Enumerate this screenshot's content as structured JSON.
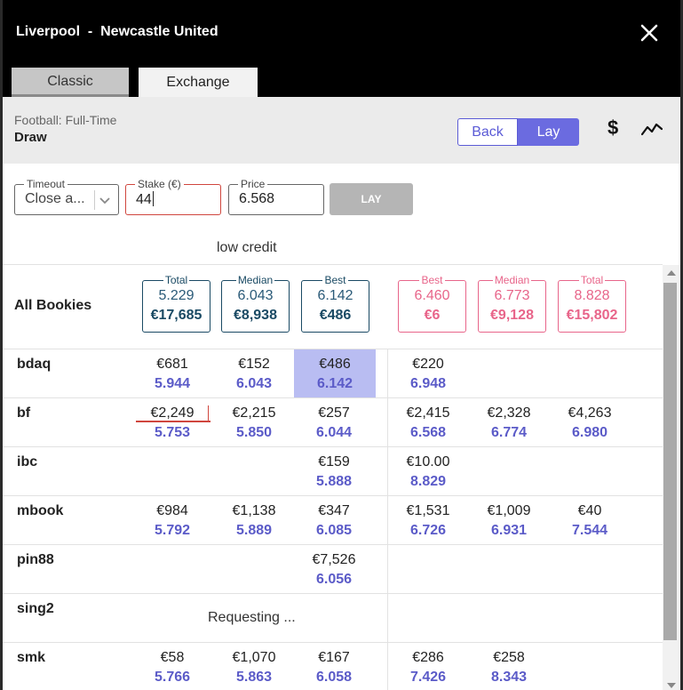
{
  "header": {
    "title": "Liverpool  -  Newcastle United"
  },
  "tabs": [
    {
      "label": "Classic"
    },
    {
      "label": "Exchange"
    }
  ],
  "market": {
    "type": "Football: Full-Time",
    "selection": "Draw"
  },
  "side_toggle": {
    "back": "Back",
    "lay": "Lay",
    "active": "Lay"
  },
  "icons": {
    "currency": "$",
    "chart": "trend-line-icon",
    "close": "close-icon"
  },
  "form": {
    "timeout": {
      "label": "Timeout",
      "value": "Close a..."
    },
    "stake": {
      "label": "Stake (€)",
      "value": "44"
    },
    "price": {
      "label": "Price",
      "value": "6.568"
    },
    "submit": "LAY"
  },
  "warning": "low credit",
  "summary": {
    "label": "All Bookies",
    "back": [
      {
        "legend": "Total",
        "price": "5.229",
        "stake": "€17,685"
      },
      {
        "legend": "Median",
        "price": "6.043",
        "stake": "€8,938"
      },
      {
        "legend": "Best",
        "price": "6.142",
        "stake": "€486"
      }
    ],
    "lay": [
      {
        "legend": "Best",
        "price": "6.460",
        "stake": "€6"
      },
      {
        "legend": "Median",
        "price": "6.773",
        "stake": "€9,128"
      },
      {
        "legend": "Total",
        "price": "8.828",
        "stake": "€15,802"
      }
    ]
  },
  "bookies": [
    {
      "name": "bdaq",
      "back": [
        {
          "stake": "€681",
          "price": "5.944"
        },
        {
          "stake": "€152",
          "price": "6.043"
        },
        {
          "stake": "€486",
          "price": "6.142",
          "highlight": true
        }
      ],
      "lay": [
        {
          "stake": "€220",
          "price": "6.948"
        },
        null,
        null
      ]
    },
    {
      "name": "bf",
      "back": [
        {
          "stake": "€2,249",
          "price": "5.753"
        },
        {
          "stake": "€2,215",
          "price": "5.850"
        },
        {
          "stake": "€257",
          "price": "6.044"
        }
      ],
      "lay": [
        {
          "stake": "€2,415",
          "price": "6.568"
        },
        {
          "stake": "€2,328",
          "price": "6.774"
        },
        {
          "stake": "€4,263",
          "price": "6.980"
        }
      ]
    },
    {
      "name": "ibc",
      "back": [
        null,
        null,
        {
          "stake": "€159",
          "price": "5.888"
        }
      ],
      "lay": [
        {
          "stake": "€10.00",
          "price": "8.829"
        },
        null,
        null
      ]
    },
    {
      "name": "mbook",
      "back": [
        {
          "stake": "€984",
          "price": "5.792"
        },
        {
          "stake": "€1,138",
          "price": "5.889"
        },
        {
          "stake": "€347",
          "price": "6.085"
        }
      ],
      "lay": [
        {
          "stake": "€1,531",
          "price": "6.726"
        },
        {
          "stake": "€1,009",
          "price": "6.931"
        },
        {
          "stake": "€40",
          "price": "7.544"
        }
      ]
    },
    {
      "name": "pin88",
      "back": [
        null,
        null,
        {
          "stake": "€7,526",
          "price": "6.056"
        }
      ],
      "lay": [
        null,
        null,
        null
      ]
    },
    {
      "name": "sing2",
      "status": "Requesting ..."
    },
    {
      "name": "smk",
      "back": [
        {
          "stake": "€58",
          "price": "5.766"
        },
        {
          "stake": "€1,070",
          "price": "5.863"
        },
        {
          "stake": "€167",
          "price": "6.058"
        }
      ],
      "lay": [
        {
          "stake": "€286",
          "price": "7.426"
        },
        {
          "stake": "€258",
          "price": "8.343"
        },
        null
      ]
    }
  ]
}
